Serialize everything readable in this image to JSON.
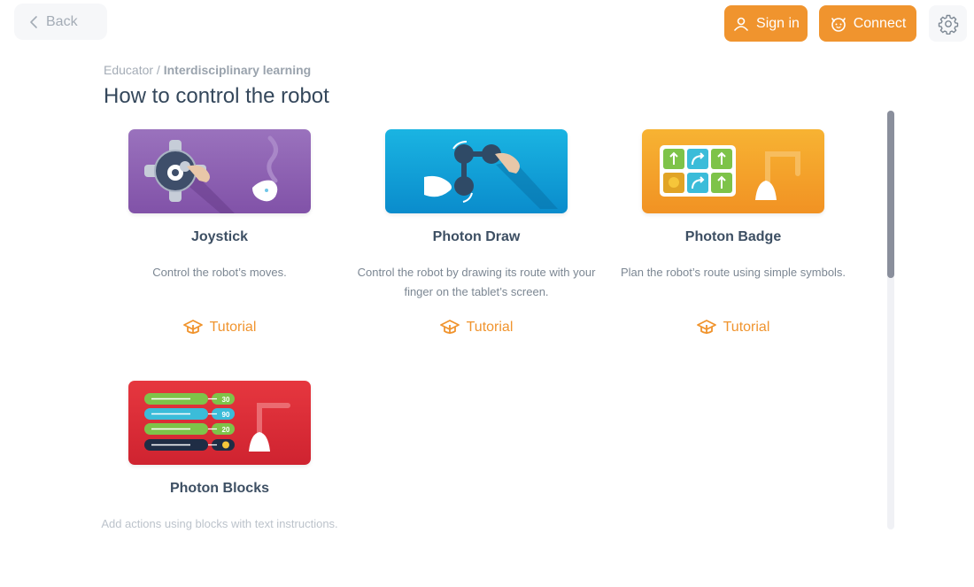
{
  "header": {
    "back_label": "Back",
    "sign_in_label": "Sign in",
    "connect_label": "Connect",
    "accent_color": "#f0942e"
  },
  "breadcrumb": {
    "parent": "Educator",
    "separator": " / ",
    "current": "Interdisciplinary learning"
  },
  "page_title": "How to control the robot",
  "cards": [
    {
      "name": "Joystick",
      "description": "Control the robot’s moves.",
      "tutorial_label": "Tutorial",
      "thumb_color": "#8e62b0"
    },
    {
      "name": "Photon Draw",
      "description": "Control the robot by drawing its route with your finger on the tablet’s screen.",
      "tutorial_label": "Tutorial",
      "thumb_color": "#1aa3d8"
    },
    {
      "name": "Photon Badge",
      "description": "Plan the robot’s route using simple symbols.",
      "tutorial_label": "Tutorial",
      "thumb_color": "#f4a42a"
    },
    {
      "name": "Photon Blocks",
      "description": "Add actions using blocks with text instructions.",
      "thumb_color": "#e0303a",
      "block_values": [
        "30",
        "90",
        "20"
      ]
    }
  ],
  "scrollbar": {
    "position_fraction": 0.0,
    "visible_fraction": 0.4
  }
}
